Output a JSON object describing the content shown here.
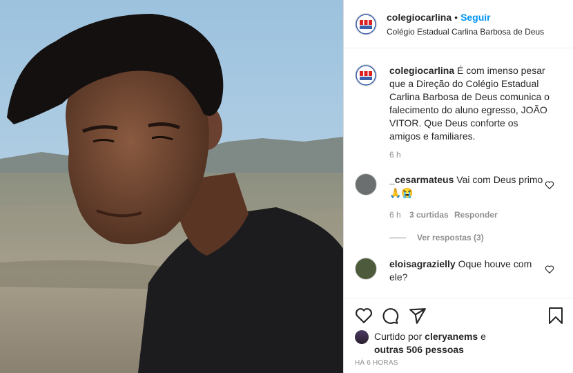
{
  "post": {
    "username": "colegiocarlina",
    "dot": "•",
    "follow_label": "Seguir",
    "location": "Colégio Estadual Carlina Barbosa de Deus",
    "caption_user": "colegiocarlina",
    "caption_text": "É com imenso pesar que a Direção do Colégio Estadual Carlina Barbosa de Deus comunica o falecimento do aluno egresso, JOÃO VITOR. Que Deus conforte os amigos e familiares.",
    "caption_time": "6 h"
  },
  "comments": [
    {
      "user": "_cesarmateus",
      "text": "Vai com Deus primo 🙏😭",
      "time": "6 h",
      "likes": "3 curtidas",
      "reply": "Responder",
      "view_replies": "Ver respostas (3)"
    },
    {
      "user": "eloisagrazielly",
      "text": "Oque houve com ele?"
    }
  ],
  "footer": {
    "liked_prefix": "Curtido por ",
    "liked_user": "cleryanems",
    "liked_mid": " e",
    "liked_others": "outras 506 pessoas",
    "timestamp": "HÁ 6 HORAS"
  },
  "colors": {
    "accent": "#0095f6",
    "text": "#262626",
    "muted": "#8e8e8e",
    "border": "#dbdbdb"
  },
  "icons": [
    "heart-icon",
    "comment-icon",
    "share-icon",
    "bookmark-icon",
    "logo-icon"
  ]
}
